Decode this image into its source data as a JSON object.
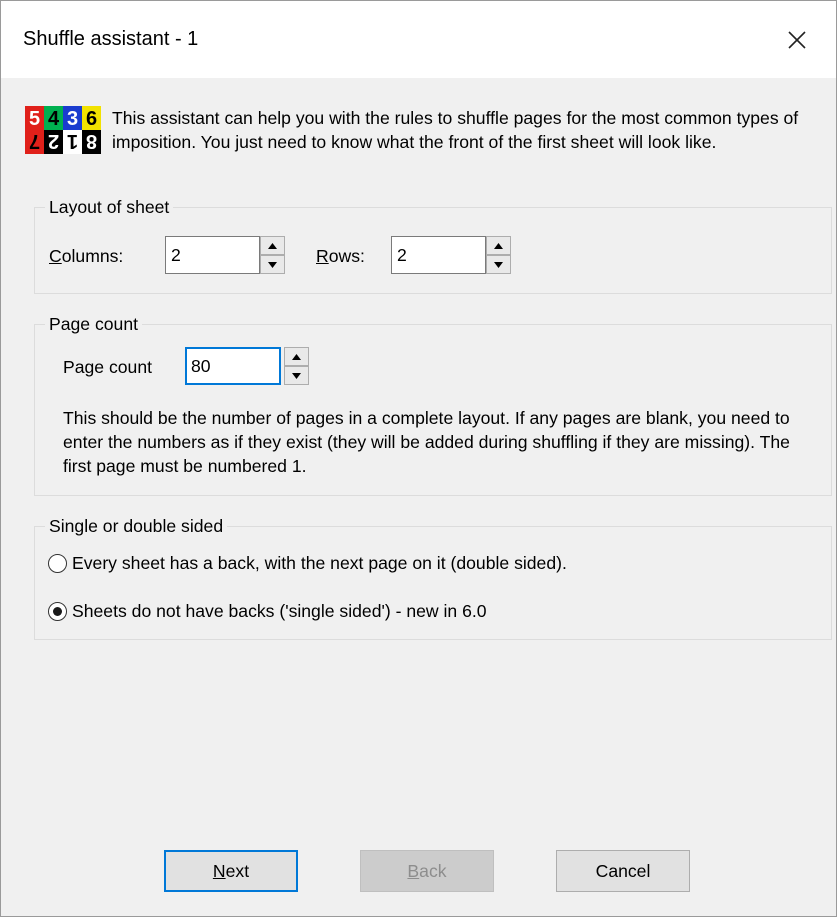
{
  "window": {
    "title": "Shuffle assistant - 1"
  },
  "intro": {
    "text": "This assistant can help you with the rules to shuffle pages for the most common types of imposition. You just need to know what the front of the first sheet will look like.",
    "logo": {
      "top": [
        "5",
        "4",
        "3",
        "6"
      ],
      "bottom": [
        "7",
        "2",
        "1",
        "8"
      ],
      "colors": [
        "#e0201a",
        "#00b050",
        "#1a3ccf",
        "#f2e200"
      ]
    }
  },
  "layout_group": {
    "legend": "Layout of sheet",
    "columns_label_first": "C",
    "columns_label_rest": "olumns:",
    "columns_value": "2",
    "rows_label_first": "R",
    "rows_label_rest": "ows:",
    "rows_value": "2"
  },
  "page_count_group": {
    "legend": "Page count",
    "label": "Page count",
    "value": "80",
    "help": "This should be the number of pages in a complete layout. If any pages are blank, you need to enter the numbers as if they exist (they will be added during shuffling if they are missing). The first page must be numbered 1."
  },
  "sides_group": {
    "legend": "Single or double sided",
    "option_double": "Every sheet has a back, with the next page on it (double sided).",
    "option_single": "Sheets do not have backs ('single sided') - new in 6.0",
    "selected": "single"
  },
  "buttons": {
    "next_first": "N",
    "next_rest": "ext",
    "back_first": "B",
    "back_rest": "ack",
    "cancel": "Cancel"
  },
  "colors": {
    "accent": "#0078d7",
    "dialog_bg": "#f0f0f0"
  }
}
